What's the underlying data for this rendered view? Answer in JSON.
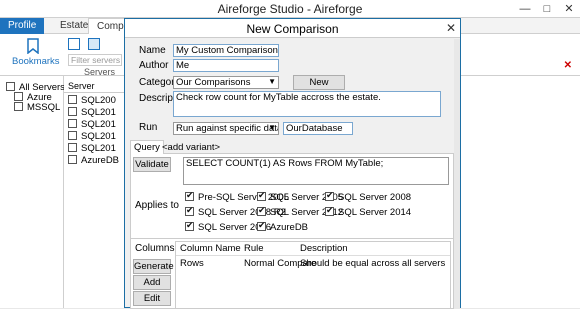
{
  "app": {
    "title": "Aireforge Studio - Aireforge"
  },
  "ribbon_tabs": [
    "Profile",
    "Estate",
    "Compare"
  ],
  "ribbon": {
    "bookmarks_label": "Bookmarks"
  },
  "left_tree": {
    "items": [
      "All Servers",
      "Azure",
      "MSSQL"
    ]
  },
  "server_panel": {
    "filter_placeholder": "Filter servers",
    "header": "Servers",
    "col_header": "Server",
    "items": [
      "SQL200",
      "SQL201",
      "SQL201",
      "SQL201",
      "SQL201",
      "AzureDB"
    ]
  },
  "dialog": {
    "title": "New Comparison",
    "name_label": "Name",
    "name_value": "My Custom Comparison",
    "author_label": "Author",
    "author_value": "Me",
    "category_label": "Category",
    "category_value": "Our Comparisons",
    "new_category_button": "New Category...",
    "description_label": "Description",
    "description_value": "Check row count for MyTable accross the estate.",
    "run_label": "Run",
    "run_value": "Run against specific database",
    "database_value": "OurDatabase",
    "tabs": [
      "Query",
      "<add variant>"
    ],
    "validate_button": "Validate",
    "query_text": "SELECT COUNT(1) AS Rows FROM MyTable;",
    "applies_to_label": "Applies to",
    "applies_to": [
      "Pre-SQL Server 2005",
      "SQL Server 2005",
      "SQL Server 2008",
      "SQL Server 2008 R2",
      "SQL Server 2012",
      "SQL Server 2014",
      "SQL Server 2016",
      "AzureDB"
    ],
    "columns_label": "Columns",
    "generate_button": "Generate",
    "add_button": "Add",
    "edit_button": "Edit",
    "grid_headers": [
      "Column Name",
      "Rule",
      "Description"
    ],
    "grid_rows": [
      {
        "column": "Rows",
        "rule": "Normal Compare",
        "description": "Should be equal across all servers"
      }
    ]
  }
}
